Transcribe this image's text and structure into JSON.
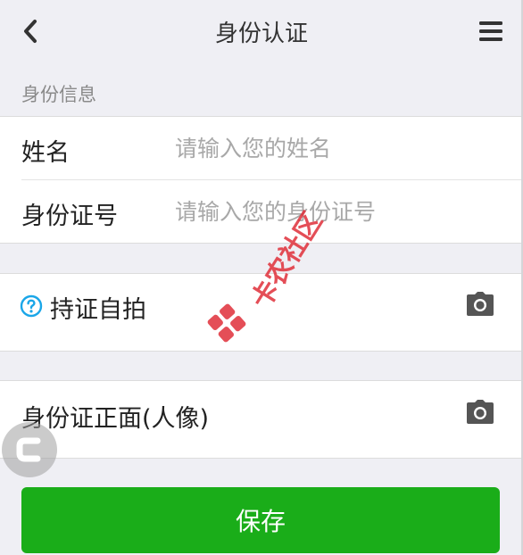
{
  "header": {
    "title": "身份认证",
    "back_icon": "chevron-left-icon",
    "menu_icon": "hamburger-menu-icon"
  },
  "identity_section": {
    "label": "身份信息",
    "name_field": {
      "label": "姓名",
      "value": "",
      "placeholder": "请输入您的姓名"
    },
    "id_number_field": {
      "label": "身份证号",
      "value": "",
      "placeholder": "请输入您的身份证号"
    }
  },
  "photos": {
    "selfie": {
      "label": "持证自拍",
      "help_icon": "question-circle-icon",
      "camera_icon": "camera-icon"
    },
    "id_front": {
      "label": "身份证正面(人像)",
      "camera_icon": "camera-icon"
    }
  },
  "actions": {
    "save_label": "保存"
  },
  "watermark": {
    "text": "卡农社区"
  },
  "colors": {
    "background": "#efeff4",
    "card": "#ffffff",
    "primary_green": "#1aad19",
    "help_blue": "#1aa6e8",
    "watermark_red": "#e0303a",
    "placeholder": "#a8a8a8",
    "section_label": "#8a8a8a"
  }
}
